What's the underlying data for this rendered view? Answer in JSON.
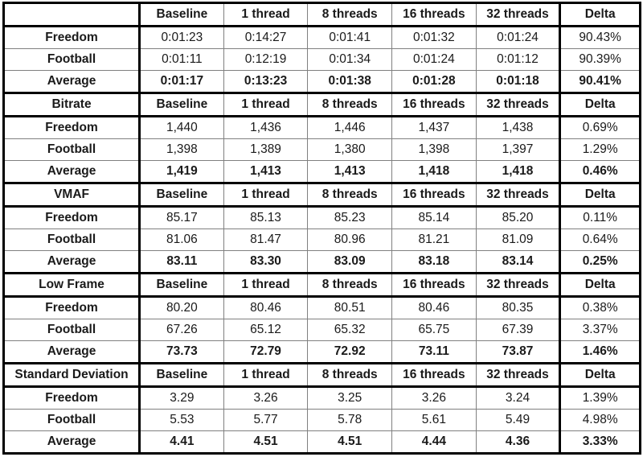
{
  "table": {
    "columns": [
      "",
      "Baseline",
      "1 thread",
      "8 threads",
      "16 threads",
      "32 threads",
      "Delta"
    ],
    "row_labels": [
      "Freedom",
      "Football",
      "Average"
    ],
    "colors": {
      "highlight_best": "#00e700",
      "highlight_worst": "#ffff00",
      "section_label": "#ff0000",
      "text": "#1a1a1a",
      "border": "#000000",
      "background": "#ffffff"
    },
    "sections": [
      {
        "label": "",
        "header": [
          "",
          "Baseline",
          "1 thread",
          "8 threads",
          "16 threads",
          "32 threads",
          "Delta"
        ],
        "rows": [
          {
            "label": "Freedom",
            "values": [
              "0:01:23",
              "0:14:27",
              "0:01:41",
              "0:01:32",
              "0:01:24",
              "90.43%"
            ],
            "fills": [
              "green",
              "yellow",
              "none",
              "none",
              "none",
              "none"
            ]
          },
          {
            "label": "Football",
            "values": [
              "0:01:11",
              "0:12:19",
              "0:01:34",
              "0:01:24",
              "0:01:12",
              "90.39%"
            ],
            "fills": [
              "green",
              "yellow",
              "none",
              "none",
              "none",
              "none"
            ]
          },
          {
            "label": "Average",
            "values": [
              "0:01:17",
              "0:13:23",
              "0:01:38",
              "0:01:28",
              "0:01:18",
              "90.41%"
            ],
            "fills": [
              "green",
              "yellow",
              "none",
              "none",
              "none",
              "none"
            ]
          }
        ]
      },
      {
        "label": "Bitrate",
        "header": [
          "Bitrate",
          "Baseline",
          "1 thread",
          "8 threads",
          "16 threads",
          "32 threads",
          "Delta"
        ],
        "rows": [
          {
            "label": "Freedom",
            "values": [
              "1,440",
              "1,436",
              "1,446",
              "1,437",
              "1,438",
              "0.69%"
            ],
            "fills": [
              "none",
              "none",
              "none",
              "none",
              "none",
              "none"
            ]
          },
          {
            "label": "Football",
            "values": [
              "1,398",
              "1,389",
              "1,380",
              "1,398",
              "1,397",
              "1.29%"
            ],
            "fills": [
              "none",
              "none",
              "none",
              "none",
              "none",
              "none"
            ]
          },
          {
            "label": "Average",
            "values": [
              "1,419",
              "1,413",
              "1,413",
              "1,418",
              "1,418",
              "0.46%"
            ],
            "fills": [
              "none",
              "none",
              "none",
              "none",
              "none",
              "none"
            ]
          }
        ]
      },
      {
        "label": "VMAF",
        "header": [
          "VMAF",
          "Baseline",
          "1 thread",
          "8 threads",
          "16 threads",
          "32 threads",
          "Delta"
        ],
        "rows": [
          {
            "label": "Freedom",
            "values": [
              "85.17",
              "85.13",
              "85.23",
              "85.14",
              "85.20",
              "0.11%"
            ],
            "fills": [
              "none",
              "yellow",
              "green",
              "none",
              "none",
              "none"
            ]
          },
          {
            "label": "Football",
            "values": [
              "81.06",
              "81.47",
              "80.96",
              "81.21",
              "81.09",
              "0.64%"
            ],
            "fills": [
              "none",
              "green",
              "yellow",
              "none",
              "none",
              "none"
            ]
          },
          {
            "label": "Average",
            "values": [
              "83.11",
              "83.30",
              "83.09",
              "83.18",
              "83.14",
              "0.25%"
            ],
            "fills": [
              "none",
              "green",
              "yellow",
              "none",
              "none",
              "none"
            ]
          }
        ]
      },
      {
        "label": "Low Frame",
        "header": [
          "Low Frame",
          "Baseline",
          "1 thread",
          "8 threads",
          "16 threads",
          "32 threads",
          "Delta"
        ],
        "rows": [
          {
            "label": "Freedom",
            "values": [
              "80.20",
              "80.46",
              "80.51",
              "80.46",
              "80.35",
              "0.38%"
            ],
            "fills": [
              "yellow",
              "none",
              "green",
              "none",
              "none",
              "none"
            ]
          },
          {
            "label": "Football",
            "values": [
              "67.26",
              "65.12",
              "65.32",
              "65.75",
              "67.39",
              "3.37%"
            ],
            "fills": [
              "none",
              "yellow",
              "none",
              "none",
              "green",
              "none"
            ]
          },
          {
            "label": "Average",
            "values": [
              "73.73",
              "72.79",
              "72.92",
              "73.11",
              "73.87",
              "1.46%"
            ],
            "fills": [
              "none",
              "yellow",
              "none",
              "none",
              "green",
              "none"
            ]
          }
        ]
      },
      {
        "label": "Standard Deviation",
        "header": [
          "Standard Deviation",
          "Baseline",
          "1 thread",
          "8 threads",
          "16 threads",
          "32 threads",
          "Delta"
        ],
        "rows": [
          {
            "label": "Freedom",
            "values": [
              "3.29",
              "3.26",
              "3.25",
              "3.26",
              "3.24",
              "1.39%"
            ],
            "fills": [
              "yellow",
              "none",
              "none",
              "none",
              "green",
              "none"
            ]
          },
          {
            "label": "Football",
            "values": [
              "5.53",
              "5.77",
              "5.78",
              "5.61",
              "5.49",
              "4.98%"
            ],
            "fills": [
              "none",
              "none",
              "yellow",
              "none",
              "green",
              "none"
            ]
          },
          {
            "label": "Average",
            "values": [
              "4.41",
              "4.51",
              "4.51",
              "4.44",
              "4.36",
              "3.33%"
            ],
            "fills": [
              "none",
              "none",
              "yellow",
              "none",
              "green",
              "none"
            ]
          }
        ]
      }
    ]
  }
}
